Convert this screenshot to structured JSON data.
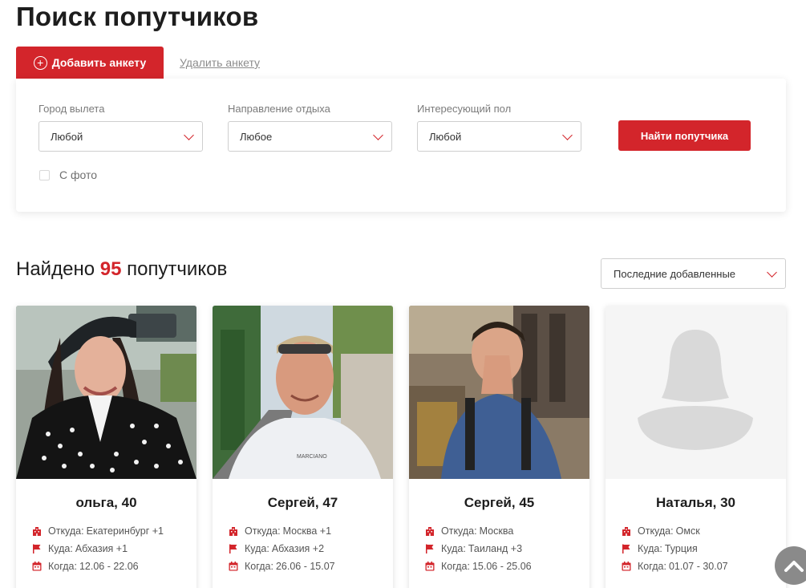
{
  "page": {
    "title": "Поиск попутчиков"
  },
  "tabs": {
    "add_label": "Добавить анкету",
    "delete_label": "Удалить анкету"
  },
  "filters": {
    "city": {
      "label": "Город вылета",
      "value": "Любой"
    },
    "direction": {
      "label": "Направление отдыха",
      "value": "Любое"
    },
    "gender": {
      "label": "Интересующий пол",
      "value": "Любой"
    },
    "with_photo_label": "С фото",
    "with_photo_checked": false,
    "find_button": "Найти попутчика"
  },
  "results": {
    "prefix": "Найдено",
    "count": "95",
    "suffix": "попутчиков",
    "sort_value": "Последние добавленные"
  },
  "labels": {
    "from": "Откуда:",
    "to": "Куда:",
    "when": "Когда:"
  },
  "cards": [
    {
      "name": "ольга, 40",
      "from": "Екатеринбург +1",
      "to": "Абхазия +1",
      "when": "12.06 - 22.06"
    },
    {
      "name": "Сергей, 47",
      "from": "Москва +1",
      "to": "Абхазия +2",
      "when": "26.06 - 15.07"
    },
    {
      "name": "Сергей, 45",
      "from": "Москва",
      "to": "Таиланд +3",
      "when": "15.06 - 25.06"
    },
    {
      "name": "Наталья, 30",
      "from": "Омск",
      "to": "Турция",
      "when": "01.07 - 30.07"
    }
  ],
  "colors": {
    "accent": "#d3252b",
    "placeholder_bg": "#f5f5f5",
    "placeholder_fg": "#d9d9d9"
  },
  "icons": {
    "from": "building-icon",
    "to": "flag-icon",
    "when": "calendar-icon",
    "scroll": "chevron-up-icon"
  }
}
